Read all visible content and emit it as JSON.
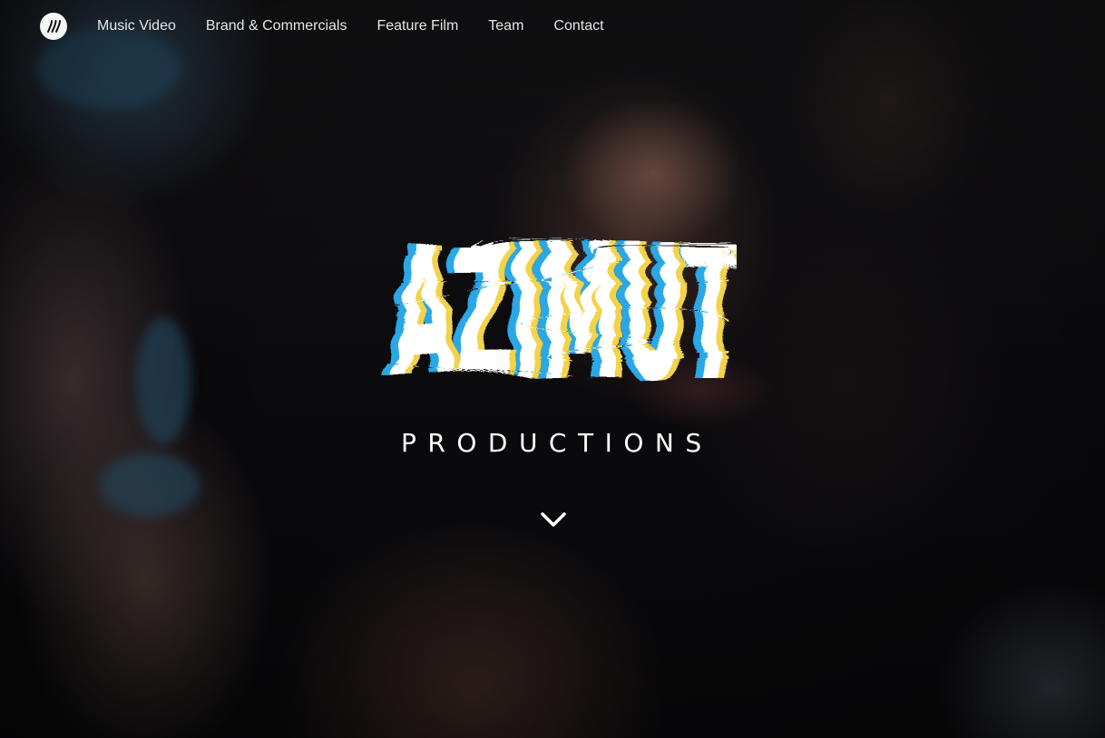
{
  "nav": {
    "logo_icon": "azimut-logo-icon",
    "items": [
      {
        "label": "Music Video"
      },
      {
        "label": "Brand & Commercials"
      },
      {
        "label": "Feature Film"
      },
      {
        "label": "Team"
      },
      {
        "label": "Contact"
      }
    ]
  },
  "hero": {
    "brand_name": "AZIMUT",
    "brand_subtitle": "PRODUCTIONS",
    "scroll_icon": "chevron-down-icon"
  },
  "colors": {
    "text": "#ffffff",
    "glitch_blue": "#2aa7e6",
    "glitch_yellow": "#f2d34a"
  }
}
